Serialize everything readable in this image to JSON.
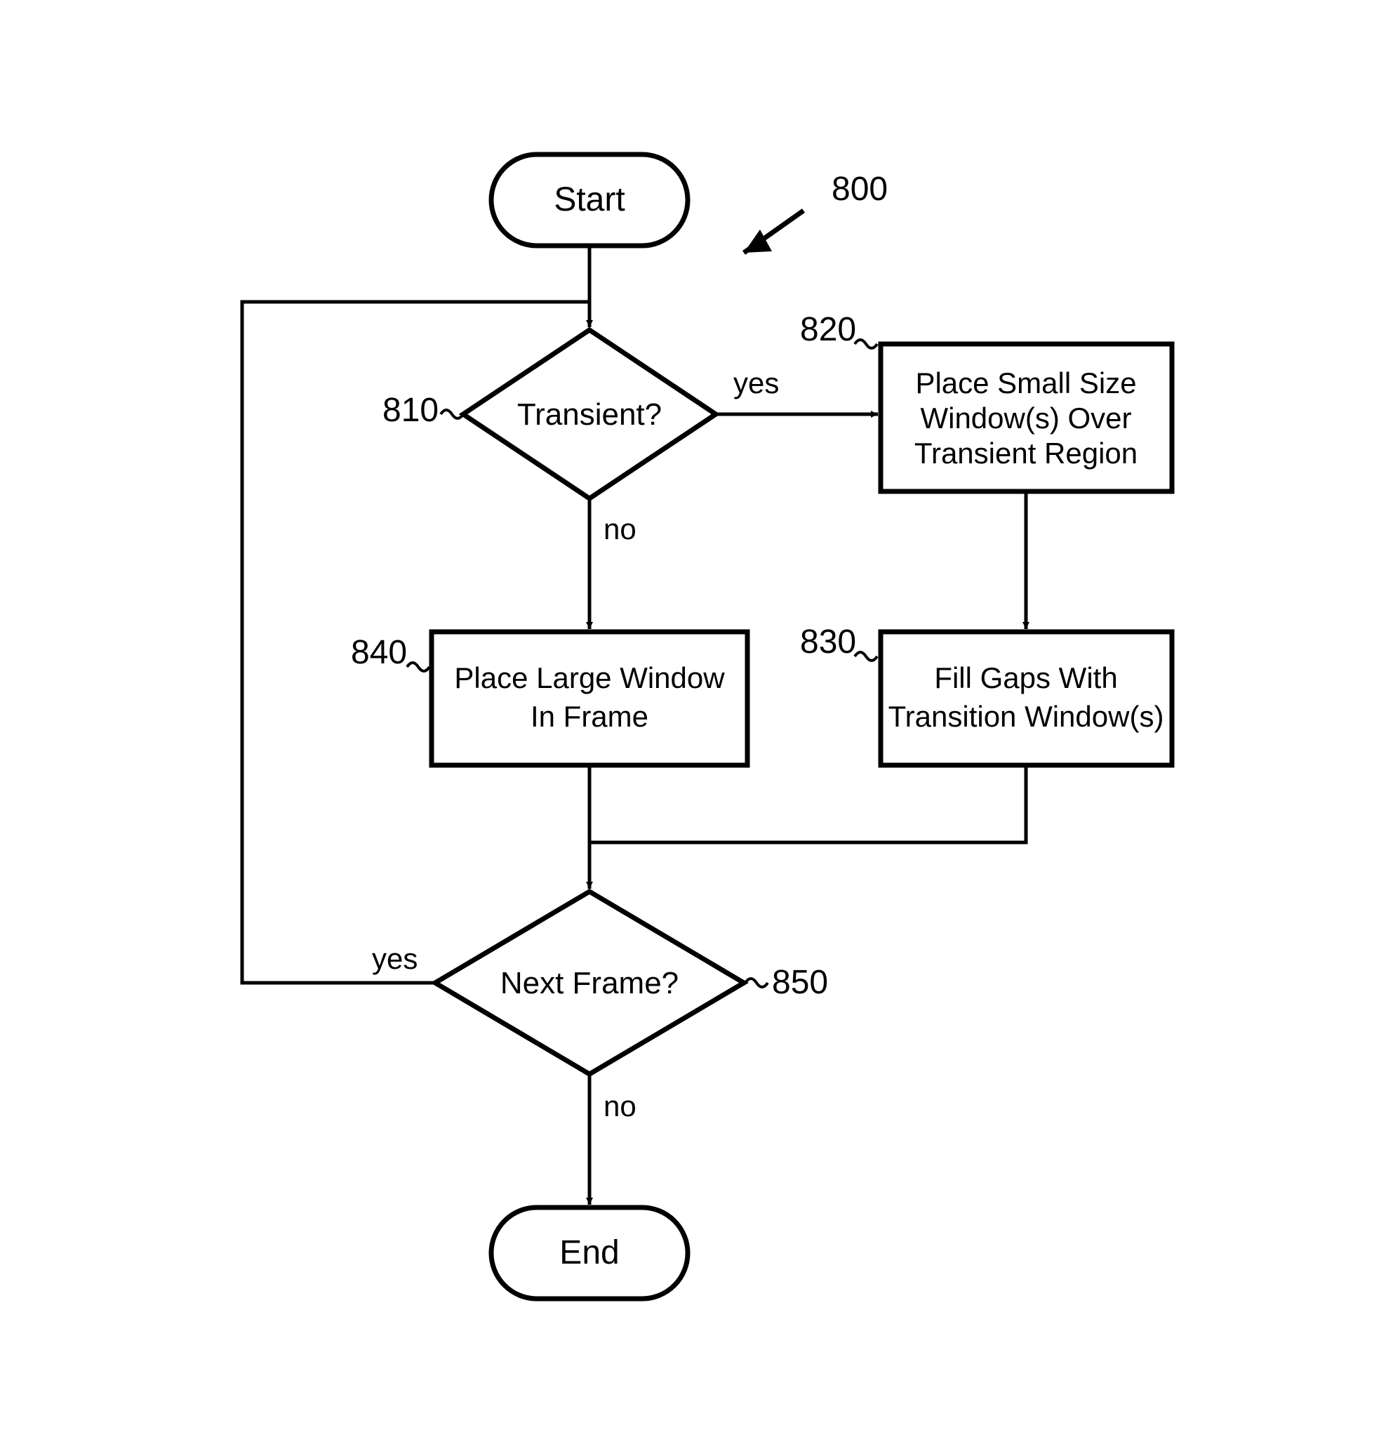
{
  "flowchart": {
    "title_ref": "800",
    "nodes": {
      "start": {
        "label": "Start"
      },
      "transient": {
        "label": "Transient?",
        "ref": "810"
      },
      "small_window": {
        "line1": "Place Small Size",
        "line2": "Window(s) Over",
        "line3": "Transient Region",
        "ref": "820"
      },
      "fill_gaps": {
        "line1": "Fill Gaps With",
        "line2": "Transition Window(s)",
        "ref": "830"
      },
      "large_window": {
        "line1": "Place Large Window",
        "line2": "In Frame",
        "ref": "840"
      },
      "next_frame": {
        "label": "Next Frame?",
        "ref": "850"
      },
      "end": {
        "label": "End"
      }
    },
    "edges": {
      "transient_yes": "yes",
      "transient_no": "no",
      "nextframe_yes": "yes",
      "nextframe_no": "no"
    }
  }
}
